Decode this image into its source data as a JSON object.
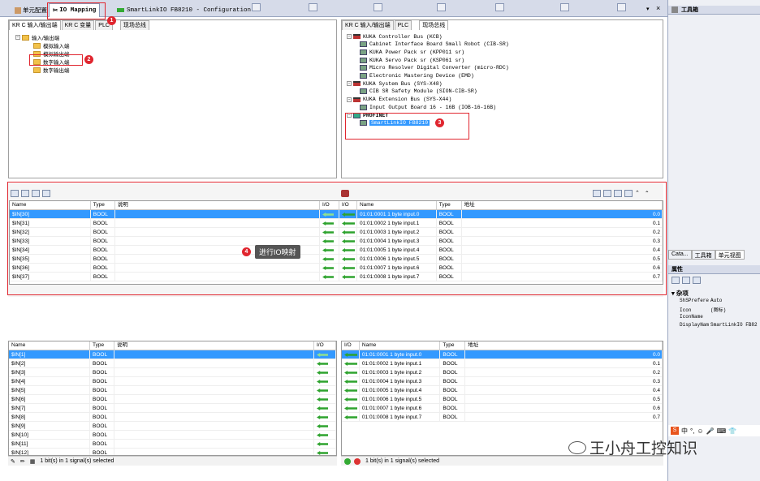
{
  "doc_tabs": {
    "unit_config": "单元配置",
    "io_mapping": "IO Mapping",
    "smartlink": "SmartLinkIO FB8210 - Configuration"
  },
  "left_panel": {
    "tabs": [
      "KR C 输入/输出端",
      "KR C 变量",
      "PLC",
      "现场总线"
    ],
    "tree": {
      "root": "输入/输出端",
      "items": [
        "模拟输入端",
        "模拟输出端",
        "数字输入端",
        "数字输出端"
      ]
    }
  },
  "right_panel": {
    "tabs": [
      "KR C 输入/输出端",
      "PLC",
      "现场总线"
    ],
    "tree": [
      {
        "label": "KUKA Controller Bus (KCB)",
        "level": 0,
        "kind": "bus"
      },
      {
        "label": "Cabinet Interface Board Small Robot (CIB-SR)",
        "level": 1,
        "kind": "dev"
      },
      {
        "label": "KUKA Power Pack sr (KPP011 sr)",
        "level": 1,
        "kind": "dev"
      },
      {
        "label": "KUKA Servo Pack sr (KSP061 sr)",
        "level": 1,
        "kind": "dev"
      },
      {
        "label": "Micro Resolver Digital Converter (micro-RDC)",
        "level": 1,
        "kind": "dev"
      },
      {
        "label": "Electronic Mastering Device (EMD)",
        "level": 1,
        "kind": "dev"
      },
      {
        "label": "KUKA System Bus (SYS-X48)",
        "level": 0,
        "kind": "bus"
      },
      {
        "label": "CIB SR Safety Module (SION-CIB-SR)",
        "level": 1,
        "kind": "dev"
      },
      {
        "label": "KUKA Extension Bus (SYS-X44)",
        "level": 0,
        "kind": "bus"
      },
      {
        "label": "Input Output Board 16 - 16B (IOB-16-16B)",
        "level": 1,
        "kind": "dev"
      },
      {
        "label": "PROFINET",
        "level": 0,
        "kind": "pn"
      },
      {
        "label": "SmartLinkIO FB8210",
        "level": 1,
        "kind": "sel"
      }
    ]
  },
  "badges": [
    "1",
    "2",
    "3",
    "4"
  ],
  "annotation": "进行IO映射",
  "headers": {
    "name": "Name",
    "type": "Type",
    "desc": "说明",
    "io": "I/O",
    "addr": "地址"
  },
  "mapped_rows": [
    {
      "name": "$IN[30]",
      "type": "BOOL",
      "fname": "01:01:0001 1 byte input.0",
      "ftype": "BOOL",
      "addr": "0.0"
    },
    {
      "name": "$IN[31]",
      "type": "BOOL",
      "fname": "01:01:0002 1 byte input.1",
      "ftype": "BOOL",
      "addr": "0.1"
    },
    {
      "name": "$IN[32]",
      "type": "BOOL",
      "fname": "01:01:0003 1 byte input.2",
      "ftype": "BOOL",
      "addr": "0.2"
    },
    {
      "name": "$IN[33]",
      "type": "BOOL",
      "fname": "01:01:0004 1 byte input.3",
      "ftype": "BOOL",
      "addr": "0.3"
    },
    {
      "name": "$IN[34]",
      "type": "BOOL",
      "fname": "01:01:0005 1 byte input.4",
      "ftype": "BOOL",
      "addr": "0.4"
    },
    {
      "name": "$IN[35]",
      "type": "BOOL",
      "fname": "01:01:0006 1 byte input.5",
      "ftype": "BOOL",
      "addr": "0.5"
    },
    {
      "name": "$IN[36]",
      "type": "BOOL",
      "fname": "01:01:0007 1 byte input.6",
      "ftype": "BOOL",
      "addr": "0.6"
    },
    {
      "name": "$IN[37]",
      "type": "BOOL",
      "fname": "01:01:0008 1 byte input.7",
      "ftype": "BOOL",
      "addr": "0.7"
    }
  ],
  "lower_left_rows": [
    "$IN[1]",
    "$IN[2]",
    "$IN[3]",
    "$IN[4]",
    "$IN[5]",
    "$IN[6]",
    "$IN[7]",
    "$IN[8]",
    "$IN[9]",
    "$IN[10]",
    "$IN[11]",
    "$IN[12]"
  ],
  "lower_right_rows": [
    {
      "fname": "01:01:0001 1 byte input.0",
      "addr": "0.0"
    },
    {
      "fname": "01:01:0002 1 byte input.1",
      "addr": "0.1"
    },
    {
      "fname": "01:01:0003 1 byte input.2",
      "addr": "0.2"
    },
    {
      "fname": "01:01:0004 1 byte input.3",
      "addr": "0.3"
    },
    {
      "fname": "01:01:0005 1 byte input.4",
      "addr": "0.4"
    },
    {
      "fname": "01:01:0006 1 byte input.5",
      "addr": "0.5"
    },
    {
      "fname": "01:01:0007 1 byte input.6",
      "addr": "0.6"
    },
    {
      "fname": "01:01:0008 1 byte input.7",
      "addr": "0.7"
    }
  ],
  "type_value": "BOOL",
  "status_left": "1 bit(s) in 1 signal(s) selected",
  "status_right": "1 bit(s) in 1 signal(s) selected",
  "right_side": {
    "toolbox": "工具箱",
    "bottom_tabs": [
      "Cata...",
      "工具箱",
      "单元视图"
    ],
    "properties": "属性",
    "category": "杂项",
    "props": [
      {
        "key": "ShSPrefere",
        "val": "Auto"
      },
      {
        "key": "Icon",
        "val": "(图标)"
      },
      {
        "key": "IconName",
        "val": ""
      },
      {
        "key": "DisplayNam",
        "val": "SmartLinkIO FB82"
      }
    ]
  },
  "watermark": "王小舟工控知识",
  "ime_label": "中"
}
